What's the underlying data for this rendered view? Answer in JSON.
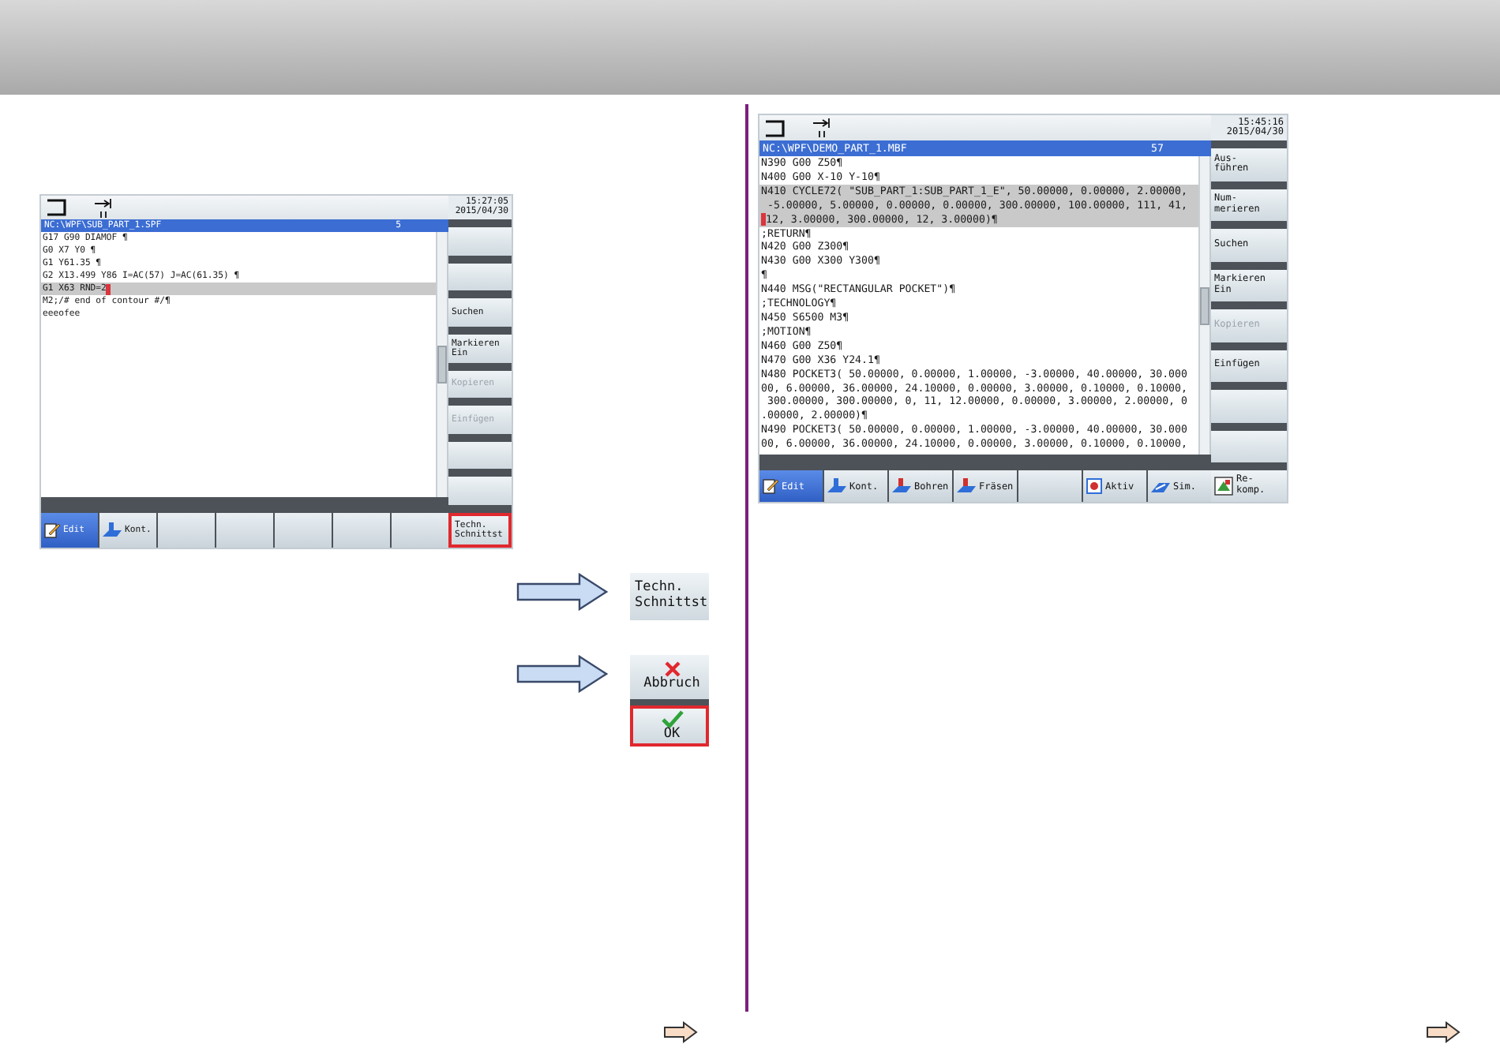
{
  "screens": [
    {
      "time": "15:27:05",
      "date": "2015/04/30",
      "path": "NC:\\WPF\\SUB_PART_1.SPF",
      "line_number": "5",
      "cursor_at_end": true,
      "lines": [
        {
          "text": "G17 G90 DIAMOF ¶",
          "highlighted": false,
          "cursor": false
        },
        {
          "text": "G0 X7 Y0 ¶",
          "highlighted": false,
          "cursor": false
        },
        {
          "text": "G1 Y61.35 ¶",
          "highlighted": false,
          "cursor": false
        },
        {
          "text": "G2 X13.499 Y86 I=AC(57) J=AC(61.35) ¶",
          "highlighted": false,
          "cursor": false
        },
        {
          "text": "G1 X63 RND=2",
          "highlighted": true,
          "cursor": true
        },
        {
          "text": "M2;/# end of contour #/¶",
          "highlighted": false,
          "cursor": false
        },
        {
          "text": "eeeofee",
          "highlighted": false,
          "cursor": false
        }
      ],
      "vertical_softkeys": [
        {
          "kind": "blank"
        },
        {
          "kind": "blank"
        },
        {
          "kind": "text",
          "label": "Suchen",
          "disabled": false
        },
        {
          "kind": "text",
          "label": "Markieren\nEin",
          "disabled": false
        },
        {
          "kind": "text",
          "label": "Kopieren",
          "disabled": true
        },
        {
          "kind": "text",
          "label": "Einfügen",
          "disabled": true
        },
        {
          "kind": "blank"
        },
        {
          "kind": "blank"
        }
      ],
      "corner_softkey": {
        "kind": "text",
        "label": "Techn.\nSchnittst",
        "highlighted": true
      },
      "horizontal_softkeys": [
        {
          "kind": "edit",
          "label": "Edit",
          "selected": true
        },
        {
          "kind": "contour",
          "label": "Kont.",
          "selected": false
        },
        {
          "kind": "blank"
        },
        {
          "kind": "blank"
        },
        {
          "kind": "blank"
        },
        {
          "kind": "blank"
        },
        {
          "kind": "blank"
        }
      ]
    },
    {
      "time": "15:45:16",
      "date": "2015/04/30",
      "path": "NC:\\WPF\\DEMO_PART_1.MBF",
      "line_number": "57",
      "cursor_at_end": false,
      "lines": [
        {
          "text": "N390 G00 Z50¶",
          "highlighted": false,
          "cursor": false
        },
        {
          "text": "N400 G00 X-10 Y-10¶",
          "highlighted": false,
          "cursor": false
        },
        {
          "text": "N410 CYCLE72( \"SUB_PART_1:SUB_PART_1_E\", 50.00000, 0.00000, 2.00000,",
          "highlighted": true,
          "cursor": false
        },
        {
          "text": " -5.00000, 5.00000, 0.00000, 0.00000, 300.00000, 100.00000, 111, 41,",
          "highlighted": true,
          "cursor": false
        },
        {
          "text": "12, 3.00000, 300.00000, 12, 3.00000)¶",
          "highlighted": true,
          "cursor": true
        },
        {
          "text": ";RETURN¶",
          "highlighted": false,
          "cursor": false
        },
        {
          "text": "N420 G00 Z300¶",
          "highlighted": false,
          "cursor": false
        },
        {
          "text": "N430 G00 X300 Y300¶",
          "highlighted": false,
          "cursor": false
        },
        {
          "text": "¶",
          "highlighted": false,
          "cursor": false
        },
        {
          "text": "N440 MSG(\"RECTANGULAR POCKET\")¶",
          "highlighted": false,
          "cursor": false
        },
        {
          "text": ";TECHNOLOGY¶",
          "highlighted": false,
          "cursor": false
        },
        {
          "text": "N450 S6500 M3¶",
          "highlighted": false,
          "cursor": false
        },
        {
          "text": ";MOTION¶",
          "highlighted": false,
          "cursor": false
        },
        {
          "text": "N460 G00 Z50¶",
          "highlighted": false,
          "cursor": false
        },
        {
          "text": "N470 G00 X36 Y24.1¶",
          "highlighted": false,
          "cursor": false
        },
        {
          "text": "N480 POCKET3( 50.00000, 0.00000, 1.00000, -3.00000, 40.00000, 30.000",
          "highlighted": false,
          "cursor": false
        },
        {
          "text": "00, 6.00000, 36.00000, 24.10000, 0.00000, 3.00000, 0.10000, 0.10000,",
          "highlighted": false,
          "cursor": false
        },
        {
          "text": " 300.00000, 300.00000, 0, 11, 12.00000, 0.00000, 3.00000, 2.00000, 0",
          "highlighted": false,
          "cursor": false
        },
        {
          "text": ".00000, 2.00000)¶",
          "highlighted": false,
          "cursor": false
        },
        {
          "text": "N490 POCKET3( 50.00000, 0.00000, 1.00000, -3.00000, 40.00000, 30.000",
          "highlighted": false,
          "cursor": false
        },
        {
          "text": "00, 6.00000, 36.00000, 24.10000, 0.00000, 3.00000, 0.10000, 0.10000,",
          "highlighted": false,
          "cursor": false
        }
      ],
      "vertical_softkeys": [
        {
          "kind": "text",
          "label": "Aus-\nführen",
          "disabled": false
        },
        {
          "kind": "text",
          "label": "Num-\nmerieren",
          "disabled": false
        },
        {
          "kind": "text",
          "label": "Suchen",
          "disabled": false
        },
        {
          "kind": "text",
          "label": "Markieren\nEin",
          "disabled": false
        },
        {
          "kind": "text",
          "label": "Kopieren",
          "disabled": true
        },
        {
          "kind": "text",
          "label": "Einfügen",
          "disabled": false
        },
        {
          "kind": "blank"
        },
        {
          "kind": "blank"
        }
      ],
      "corner_softkey": {
        "kind": "recompile",
        "label": "Re-\nkomp.",
        "highlighted": false
      },
      "horizontal_softkeys": [
        {
          "kind": "edit",
          "label": "Edit",
          "selected": true
        },
        {
          "kind": "contour",
          "label": "Kont.",
          "selected": false
        },
        {
          "kind": "drill",
          "label": "Bohren",
          "selected": false
        },
        {
          "kind": "mill",
          "label": "Fräsen",
          "selected": false
        },
        {
          "kind": "blank"
        },
        {
          "kind": "active",
          "label": "Aktiv",
          "selected": false
        },
        {
          "kind": "sim",
          "label": "Sim.",
          "selected": false
        }
      ]
    }
  ],
  "steps": [
    {
      "kind": "single",
      "buttons": [
        {
          "label": "Techn.\nSchnittst",
          "highlighted": false
        }
      ]
    },
    {
      "kind": "stack",
      "buttons": [
        {
          "kind": "cancel",
          "label": "Abbruch",
          "highlighted": false
        },
        {
          "kind": "ok",
          "label": "OK",
          "highlighted": true
        }
      ]
    }
  ]
}
